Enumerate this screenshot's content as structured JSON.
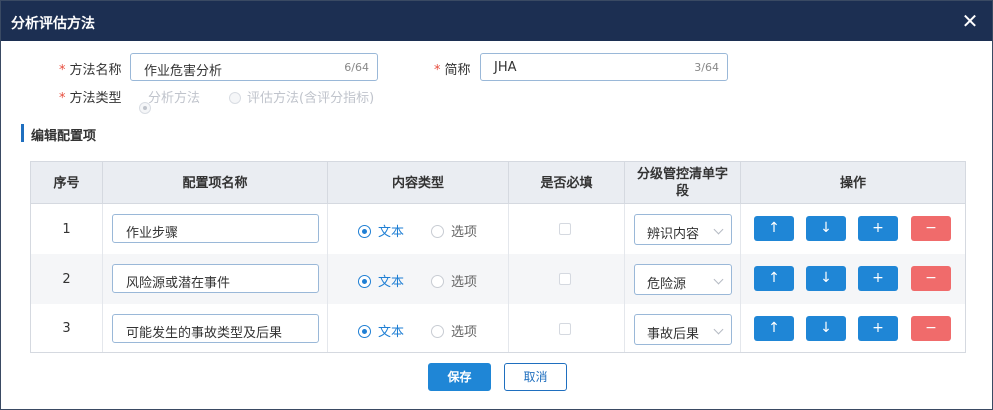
{
  "dialog": {
    "title": "分析评估方法"
  },
  "form": {
    "method_name": {
      "label": "方法名称",
      "value": "作业危害分析",
      "counter": "6/64"
    },
    "short_name": {
      "label": "简称",
      "value": "JHA",
      "counter": "3/64"
    },
    "method_type": {
      "label": "方法类型",
      "options": [
        "分析方法",
        "评估方法(含评分指标)"
      ],
      "selected": "分析方法"
    }
  },
  "section": {
    "title": "编辑配置项"
  },
  "table": {
    "headers": [
      "序号",
      "配置项名称",
      "内容类型",
      "是否必填",
      "分级管控清单字段",
      "操作"
    ],
    "content_type_options": [
      "文本",
      "选项"
    ],
    "rows": [
      {
        "seq": "1",
        "name": "作业步骤",
        "type": "文本",
        "required": false,
        "field": "辨识内容"
      },
      {
        "seq": "2",
        "name": "风险源或潜在事件",
        "type": "文本",
        "required": false,
        "field": "危险源"
      },
      {
        "seq": "3",
        "name": "可能发生的事故类型及后果",
        "type": "文本",
        "required": false,
        "field": "事故后果"
      }
    ],
    "op_icons": {
      "up": "↑",
      "down": "↓",
      "add": "+",
      "remove": "−"
    }
  },
  "footer": {
    "save_label": "保存",
    "cancel_label": "取消"
  },
  "colors": {
    "titlebar": "#1c2f52",
    "accent": "#1f86d6",
    "danger": "#f06b6b"
  }
}
